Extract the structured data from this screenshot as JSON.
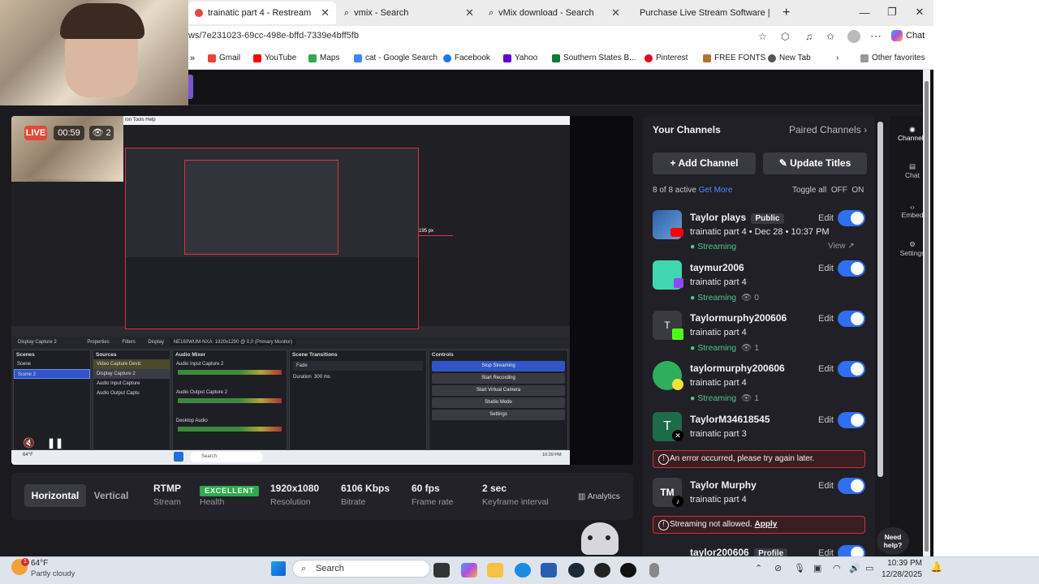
{
  "browser": {
    "tabs": [
      {
        "label": "trainatic part 4 - Restream",
        "active": true
      },
      {
        "label": "vmix - Search"
      },
      {
        "label": "vMix download - Search"
      },
      {
        "label": "Purchase Live Stream Software | vMix"
      }
    ],
    "url": "ws/7e231023-69cc-498e-bffd-7339e4bff5fb",
    "bookmarks": [
      "Gmail",
      "YouTube",
      "Maps",
      "cat - Google Search",
      "Facebook",
      "Yahoo",
      "Southern States B...",
      "Pinterest",
      "FREE FONTS",
      "New Tab"
    ],
    "other_favorites": "Other favorites",
    "chat_label": "Chat",
    "bookmark_colors": {
      "Gmail": "#ea4335",
      "YouTube": "#ff0000",
      "Maps": "#34a853",
      "cat - Google Search": "#4285f4",
      "Facebook": "#1877f2",
      "Yahoo": "#6001d2",
      "Southern States B...": "#0a7a3b",
      "Pinterest": "#e60023",
      "FREE FONTS": "#b0762d",
      "New Tab": "#555555"
    }
  },
  "preview": {
    "live": "LIVE",
    "timer": "00:59",
    "viewers": "2",
    "obs": {
      "menu": "ion   Tools   Help",
      "source_bar": "Display Capture 2",
      "properties": "Properties",
      "filters": "Filters",
      "display": "Display",
      "display_value": "NE160WUM-NXA: 1920x1200 @ 0,0 (Primary Monitor)",
      "dimension": "195 px",
      "scenes_head": "Scenes",
      "scenes": [
        "Scene",
        "Scene 2"
      ],
      "sources_head": "Sources",
      "sources": [
        "Video Capture Devic",
        "Display Capture 2",
        "Audio Input Capture",
        "Audio Output Captu"
      ],
      "mixer_head": "Audio Mixer",
      "mixer": [
        "Audio Input Capture 2",
        "Audio Output Capture 2",
        "Desktop Audio"
      ],
      "transitions_head": "Scene Transitions",
      "transition": "Fade",
      "duration_label": "Duration",
      "duration": "300 ms",
      "controls_head": "Controls",
      "controls": [
        "Stop Streaming",
        "Start Recording",
        "Start Virtual Camera",
        "Studio Mode",
        "Settings"
      ],
      "search": "Search",
      "clock": "10:39 PM",
      "weather": "64°F"
    }
  },
  "stats": {
    "horizontal": "Horizontal",
    "vertical": "Vertical",
    "items": [
      {
        "value": "RTMP",
        "label": "Stream"
      },
      {
        "value": "EXCELLENT",
        "label": "Health"
      },
      {
        "value": "1920x1080",
        "label": "Resolution"
      },
      {
        "value": "6106 Kbps",
        "label": "Bitrate"
      },
      {
        "value": "60 fps",
        "label": "Frame rate"
      },
      {
        "value": "2 sec",
        "label": "Keyframe interval"
      }
    ],
    "analytics": "Analytics"
  },
  "side": {
    "your_channels": "Your Channels",
    "paired": "Paired Channels",
    "add_channel": "Add Channel",
    "update_titles": "Update Titles",
    "active": "8 of 8 active",
    "get_more": "Get More",
    "toggle_all": "Toggle all",
    "off": "OFF",
    "on": "ON",
    "edit": "Edit",
    "channels": [
      {
        "name": "Taylor plays",
        "badge": "Public",
        "title": "trainatic part 4",
        "date": "Dec 28 • 10:37 PM",
        "status": "Streaming",
        "view": "View",
        "platform": "youtube"
      },
      {
        "name": "taymur2006",
        "title": "trainatic part 4",
        "status": "Streaming",
        "viewers": "0",
        "platform": "twitch"
      },
      {
        "name": "Taylormurphy200606",
        "title": "trainatic part 4",
        "status": "Streaming",
        "viewers": "1",
        "platform": "kick",
        "initial": "T"
      },
      {
        "name": "taylormurphy200606",
        "title": "trainatic part 4",
        "status": "Streaming",
        "viewers": "1",
        "platform": "trovo"
      },
      {
        "name": "TaylorM34618545",
        "title": "trainatic part 3",
        "platform": "x",
        "initial": "T"
      },
      {
        "name": "Taylor Murphy",
        "title": "trainatic part 4",
        "platform": "tiktok",
        "initial": "TM"
      },
      {
        "name": "taylor200606",
        "badge": "Profile",
        "platform": "other"
      }
    ],
    "error1": "An error occurred, please try again later.",
    "error2": "Streaming not allowed.",
    "error2_link": "Apply",
    "need_help": "Need help?"
  },
  "rail": [
    "Channels",
    "Chat",
    "Embed",
    "Settings"
  ],
  "taskbar": {
    "weather_temp": "64°F",
    "weather_desc": "Partly cloudy",
    "weather_badge": "1",
    "search": "Search",
    "time": "10:39 PM",
    "date": "12/28/2025"
  }
}
